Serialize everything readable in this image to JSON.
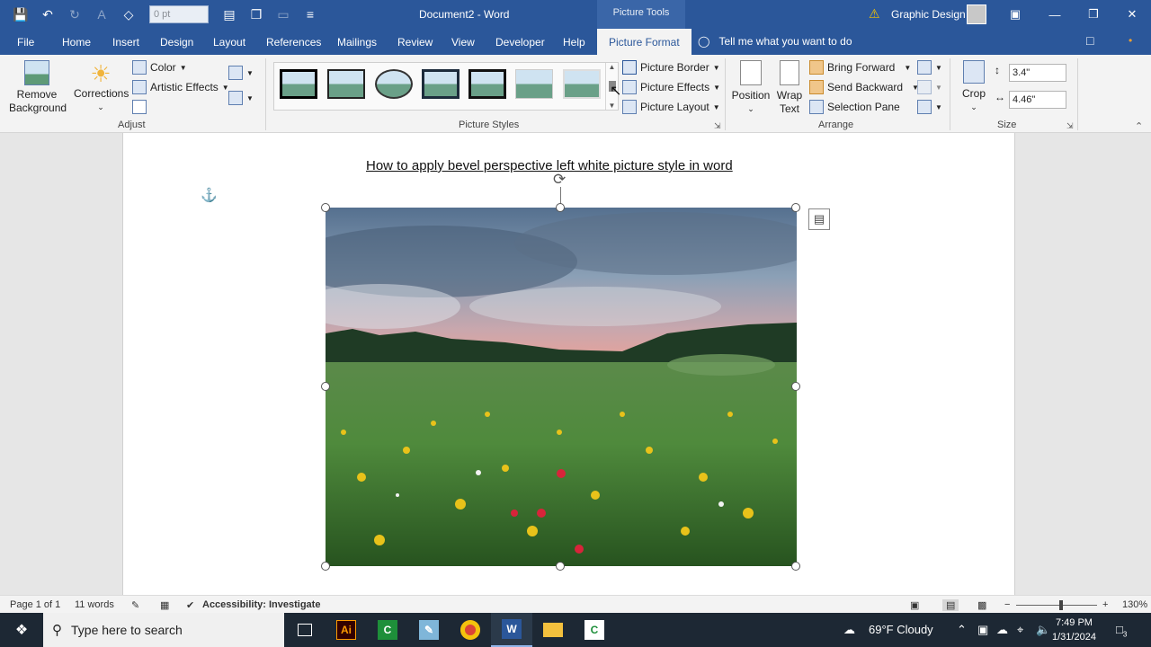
{
  "titlebar": {
    "font_size_value": "0 pt",
    "document_title": "Document2 - Word",
    "context_group": "Picture Tools",
    "user_name": "Graphic Design"
  },
  "tabs": [
    "File",
    "Home",
    "Insert",
    "Design",
    "Layout",
    "References",
    "Mailings",
    "Review",
    "View",
    "Developer",
    "Help"
  ],
  "active_tab": "Picture Format",
  "tell_me": "Tell me what you want to do",
  "ribbon": {
    "adjust": {
      "remove_background": [
        "Remove",
        "Background"
      ],
      "corrections": "Corrections",
      "color": "Color",
      "artistic_effects": "Artistic Effects",
      "label": "Adjust"
    },
    "picture_styles": {
      "border": "Picture Border",
      "effects": "Picture Effects",
      "layout": "Picture Layout",
      "label": "Picture Styles"
    },
    "arrange": {
      "position": "Position",
      "wrap_text": [
        "Wrap",
        "Text"
      ],
      "bring_forward": "Bring Forward",
      "send_backward": "Send Backward",
      "selection_pane": "Selection Pane",
      "label": "Arrange"
    },
    "size": {
      "crop": "Crop",
      "height": "3.4\"",
      "width": "4.46\"",
      "label": "Size"
    }
  },
  "document": {
    "heading": "How to apply bevel perspective left white picture style in word"
  },
  "status": {
    "page": "Page 1 of 1",
    "words": "11 words",
    "accessibility": "Accessibility: Investigate",
    "zoom": "130%"
  },
  "taskbar": {
    "search_placeholder": "Type here to search",
    "weather": "69°F  Cloudy",
    "time": "7:49 PM",
    "date": "1/31/2024",
    "notification_count": "3"
  },
  "colors": {
    "word_blue": "#2b579a",
    "ribbon_bg": "#f3f3f3",
    "taskbar_bg": "#1d2834"
  }
}
